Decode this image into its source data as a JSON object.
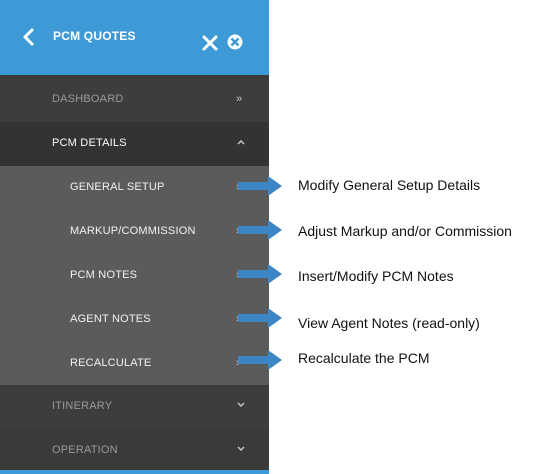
{
  "header": {
    "title": "PCM QUOTES"
  },
  "nav": {
    "dashboard": "DASHBOARD",
    "pcm_details": "PCM DETAILS",
    "sub_items": [
      "GENERAL SETUP",
      "MARKUP/COMMISSION",
      "PCM NOTES",
      "AGENT NOTES",
      "RECALCULATE"
    ],
    "itinerary": "ITINERARY",
    "operation": "OPERATION"
  },
  "annotations": [
    "Modify General Setup Details",
    "Adjust Markup and/or Commission",
    "Insert/Modify PCM Notes",
    "View Agent Notes (read-only)",
    "Recalculate the PCM"
  ],
  "colors": {
    "header": "#3d9ad6",
    "panel": "#3a3a3a",
    "submenu": "#5b5b5b",
    "arrow": "#3d86c6"
  },
  "icons": [
    "back-arrow-icon",
    "close-icon",
    "pin-icon",
    "chevron-double-right-icon",
    "chevron-up-icon",
    "chevron-right-icon",
    "chevron-down-icon",
    "callout-arrow-icon"
  ]
}
